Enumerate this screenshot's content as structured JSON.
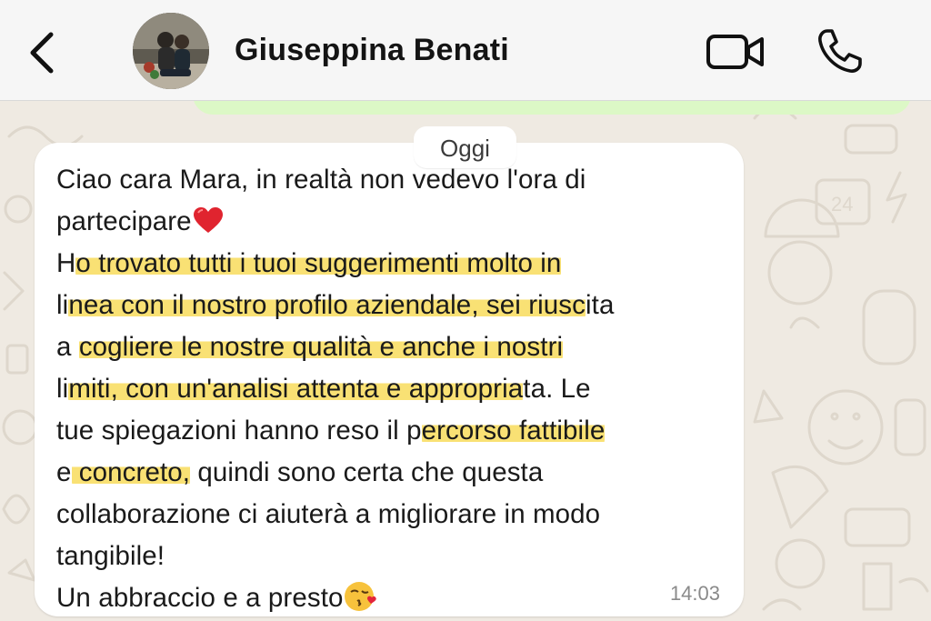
{
  "header": {
    "back_icon": "chevron-left-icon",
    "contact_name": "Giuseppina Benati",
    "video_icon": "video-camera-icon",
    "call_icon": "phone-icon"
  },
  "date_divider": "Oggi",
  "message": {
    "lines": {
      "l1": "Ciao cara Mara, in realtà non vedevo l'ora di",
      "l2": "partecipare",
      "l3_pre": "H",
      "l3_hl": "o trovato tutti i tuoi suggerimenti molto in",
      "l4_pre": "li",
      "l4_hl": "nea con il nostro profilo aziendale, sei riusc",
      "l4_post": "ita",
      "l5_pre": "a ",
      "l5_hl": "cogliere le nostre qualità e anche i nostri",
      "l6_pre": "li",
      "l6_hl": "miti, con un'analisi attenta e appropria",
      "l6_post": "ta. Le",
      "l7_pre": "tue spiegazioni hanno reso il p",
      "l7_hl": "ercorso fattibile",
      "l8_pre": "e",
      "l8_hl": " concreto,",
      "l8_post": " quindi sono certa che questa",
      "l9": "collaborazione ci aiuterà a migliorare in modo",
      "l10": "tangibile!",
      "l11": "Un abbraccio e a presto"
    },
    "emoji": [
      "red-heart-emoji",
      "kissing-face-emoji"
    ],
    "highlight_color": "#f9e174",
    "time": "14:03"
  },
  "colors": {
    "wallpaper": "#efeae2",
    "incoming_bubble": "#ffffff",
    "outgoing_bubble": "#dcf8c6",
    "header": "#f6f6f6"
  }
}
